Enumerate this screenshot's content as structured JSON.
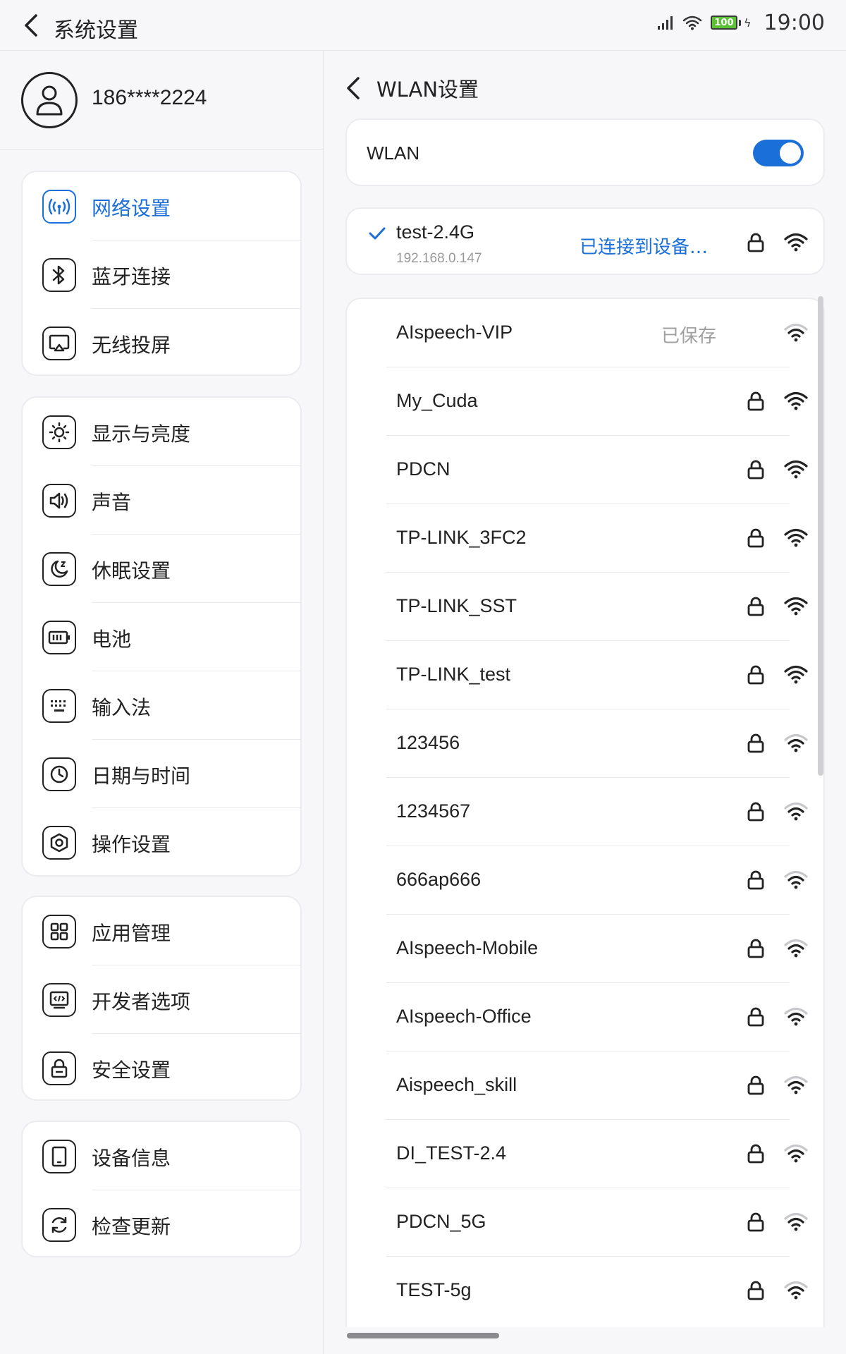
{
  "topbar": {
    "title": "系统设置",
    "battery_level": "100",
    "time": "19:00"
  },
  "profile": {
    "phone": "186****2224"
  },
  "menu": {
    "group1": [
      {
        "label": "网络设置",
        "icon": "wifi-signal-icon",
        "active": true
      },
      {
        "label": "蓝牙连接",
        "icon": "bluetooth-icon"
      },
      {
        "label": "无线投屏",
        "icon": "screen-cast-icon"
      }
    ],
    "group2": [
      {
        "label": "显示与亮度",
        "icon": "brightness-icon"
      },
      {
        "label": "声音",
        "icon": "speaker-icon"
      },
      {
        "label": "休眠设置",
        "icon": "sleep-moon-icon"
      },
      {
        "label": "电池",
        "icon": "battery-icon"
      },
      {
        "label": "输入法",
        "icon": "keyboard-icon"
      },
      {
        "label": "日期与时间",
        "icon": "clock-icon"
      },
      {
        "label": "操作设置",
        "icon": "hexagon-settings-icon"
      }
    ],
    "group3": [
      {
        "label": "应用管理",
        "icon": "app-grid-icon"
      },
      {
        "label": "开发者选项",
        "icon": "developer-icon"
      },
      {
        "label": "安全设置",
        "icon": "lock-icon"
      }
    ],
    "group4": [
      {
        "label": "设备信息",
        "icon": "device-info-icon"
      },
      {
        "label": "检查更新",
        "icon": "refresh-icon"
      }
    ]
  },
  "wlan": {
    "page_title": "WLAN设置",
    "toggle_label": "WLAN",
    "enabled": true,
    "connected": {
      "ssid": "test-2.4G",
      "ip": "192.168.0.147",
      "status": "已连接到设备…"
    },
    "networks": [
      {
        "ssid": "AIspeech-VIP",
        "status": "已保存",
        "locked": false,
        "strength": "weak"
      },
      {
        "ssid": "My_Cuda",
        "locked": true,
        "strength": "strong"
      },
      {
        "ssid": "PDCN",
        "locked": true,
        "strength": "strong"
      },
      {
        "ssid": "TP-LINK_3FC2",
        "locked": true,
        "strength": "strong"
      },
      {
        "ssid": "TP-LINK_SST",
        "locked": true,
        "strength": "strong"
      },
      {
        "ssid": "TP-LINK_test",
        "locked": true,
        "strength": "strong"
      },
      {
        "ssid": "123456",
        "locked": true,
        "strength": "weak"
      },
      {
        "ssid": "1234567",
        "locked": true,
        "strength": "weak"
      },
      {
        "ssid": "666ap666",
        "locked": true,
        "strength": "weak"
      },
      {
        "ssid": "AIspeech-Mobile",
        "locked": true,
        "strength": "weak"
      },
      {
        "ssid": "AIspeech-Office",
        "locked": true,
        "strength": "weak"
      },
      {
        "ssid": "Aispeech_skill",
        "locked": true,
        "strength": "weak"
      },
      {
        "ssid": "DI_TEST-2.4",
        "locked": true,
        "strength": "weak"
      },
      {
        "ssid": "PDCN_5G",
        "locked": true,
        "strength": "weak"
      },
      {
        "ssid": "TEST-5g",
        "locked": true,
        "strength": "weak"
      }
    ]
  },
  "colors": {
    "accent": "#1b6fd9",
    "text": "#222222",
    "muted": "#999999",
    "battery": "#5bc236"
  }
}
